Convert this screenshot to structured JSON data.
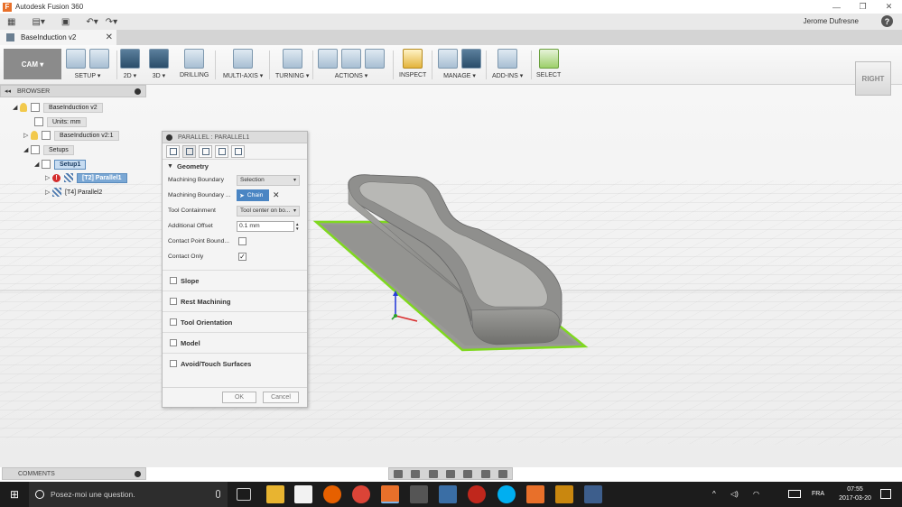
{
  "window": {
    "title": "Autodesk Fusion 360",
    "user": "Jerome Dufresne",
    "help": "?"
  },
  "doc_tab": {
    "label": "BaseInduction v2"
  },
  "toolbar": {
    "workspace": "CAM ▾",
    "groups": [
      "SETUP ▾",
      "2D ▾",
      "3D ▾",
      "DRILLING",
      "MULTI-AXIS ▾",
      "TURNING ▾",
      "ACTIONS ▾",
      "INSPECT",
      "MANAGE ▾",
      "ADD-INS ▾",
      "SELECT"
    ]
  },
  "browser": {
    "title": "BROWSER",
    "root": "BaseInduction v2",
    "units": "Units: mm",
    "component": "BaseInduction v2:1",
    "setups": "Setups",
    "setup1": "Setup1",
    "op1": "[T2] Parallel1",
    "op2": "[T4] Parallel2"
  },
  "dialog": {
    "title": "PARALLEL : PARALLEL1",
    "geometry": "Geometry",
    "rows": {
      "boundary_label": "Machining Boundary",
      "boundary_value": "Selection",
      "boundary_sel_label": "Machining Boundary ...",
      "chain": "Chain",
      "containment_label": "Tool Containment",
      "containment_value": "Tool center on bo...",
      "offset_label": "Additional Offset",
      "offset_value": "0.1 mm",
      "contact_boundary_label": "Contact Point Bound...",
      "contact_only_label": "Contact Only"
    },
    "contact_only_checked": true,
    "contact_boundary_checked": false,
    "sections": [
      "Slope",
      "Rest Machining",
      "Tool Orientation",
      "Model",
      "Avoid/Touch Surfaces"
    ],
    "ok": "OK",
    "cancel": "Cancel"
  },
  "viewcube": {
    "face": "RIGHT"
  },
  "comments": {
    "label": "COMMENTS"
  },
  "taskbar": {
    "search_placeholder": "Posez-moi une question.",
    "lang": "FRA",
    "time": "07:55",
    "date": "2017-03-20"
  },
  "colors": {
    "part_gray": "#8f8f8d",
    "boundary_green": "#7fd81f",
    "selection_blue": "#4a85c3",
    "taskbar": "#1c1c1c"
  }
}
